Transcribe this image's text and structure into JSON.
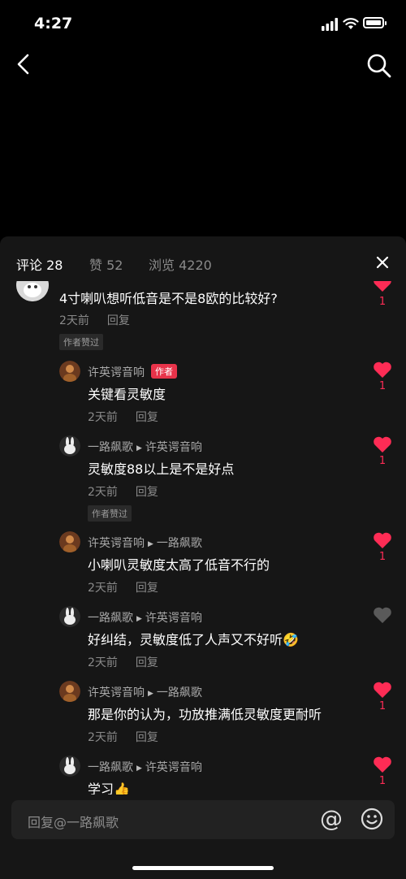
{
  "status": {
    "time": "4:27"
  },
  "tabs": [
    {
      "label": "评论 28"
    },
    {
      "label": "赞 52"
    },
    {
      "label": "浏览 4220"
    }
  ],
  "top_comment": {
    "text": "4寸喇叭想听低音是不是8欧的比较好?",
    "time": "2天前",
    "reply_label": "回复",
    "liked_tag": "作者赞过",
    "likes": "1"
  },
  "replies": [
    {
      "author": "许英谔音响",
      "badge": "作者",
      "text": "关键看灵敏度",
      "time": "2天前",
      "reply_label": "回复",
      "likes": "1",
      "liked": true
    },
    {
      "author": "一路飙歌",
      "to": "许英谔音响",
      "text": "灵敏度88以上是不是好点",
      "time": "2天前",
      "reply_label": "回复",
      "liked_tag": "作者赞过",
      "likes": "1",
      "liked": true
    },
    {
      "author": "许英谔音响",
      "to": "一路飙歌",
      "text": "小喇叭灵敏度太高了低音不行的",
      "time": "2天前",
      "reply_label": "回复",
      "likes": "1",
      "liked": true
    },
    {
      "author": "一路飙歌",
      "to": "许英谔音响",
      "text": "好纠结，灵敏度低了人声又不好听🤣",
      "time": "2天前",
      "reply_label": "回复",
      "likes": "",
      "liked": false
    },
    {
      "author": "许英谔音响",
      "to": "一路飙歌",
      "text": "那是你的认为，功放推满低灵敏度更耐听",
      "time": "2天前",
      "reply_label": "回复",
      "likes": "1",
      "liked": true
    },
    {
      "author": "一路飙歌",
      "to": "许英谔音响",
      "text": "学习👍",
      "time": "",
      "reply_label": "",
      "likes": "1",
      "liked": true
    }
  ],
  "input": {
    "placeholder": "回复@一路飙歌"
  },
  "icons": [
    "back-arrow-icon",
    "search-icon",
    "close-icon",
    "heart-icon",
    "at-icon",
    "emoji-icon",
    "signal-icon",
    "wifi-icon",
    "battery-icon"
  ],
  "colors": {
    "accent": "#fe2c55",
    "sheet": "#161616",
    "badge": "#e8334a"
  }
}
